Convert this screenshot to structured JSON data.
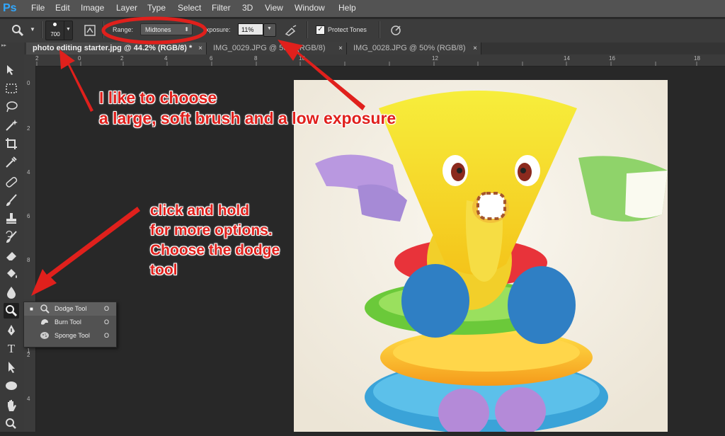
{
  "app": {
    "logo": "Ps"
  },
  "menu": [
    "File",
    "Edit",
    "Image",
    "Layer",
    "Type",
    "Select",
    "Filter",
    "3D",
    "View",
    "Window",
    "Help"
  ],
  "options": {
    "brush_size": "700",
    "range_label": "Range:",
    "range_value": "Midtones",
    "exposure_label": "xposure:",
    "exposure_value": "11%",
    "protect_tones_label": "Protect Tones",
    "protect_tones_checked": "✓"
  },
  "tabs": [
    {
      "label": "photo editing starter.jpg @ 44.2% (RGB/8) *",
      "close": "×"
    },
    {
      "label": "IMG_0029.JPG @ 50% (RGB/8)",
      "close": "×"
    },
    {
      "label": "IMG_0028.JPG @ 50% (RGB/8)",
      "close": "×"
    }
  ],
  "ruler_top_ticks": [
    "2",
    "0",
    "2",
    "4",
    "6",
    "8",
    "10",
    "12",
    "14",
    "16",
    "18"
  ],
  "ruler_left_ticks": [
    "0",
    "2",
    "4",
    "6",
    "8",
    "1",
    "2",
    "4"
  ],
  "flyout": [
    {
      "label": "Dodge Tool",
      "key": "O",
      "icon": "dodge-icon"
    },
    {
      "label": "Burn Tool",
      "key": "O",
      "icon": "burn-icon"
    },
    {
      "label": "Sponge Tool",
      "key": "O",
      "icon": "sponge-icon"
    }
  ],
  "annotations": {
    "top": "I like to choose\na large, soft brush and a low exposure",
    "left": "click and hold\nfor more options.\nChoose the dodge\ntool"
  },
  "colors": {
    "annotation": "#e0201c",
    "ps_blue": "#31a8ff"
  }
}
